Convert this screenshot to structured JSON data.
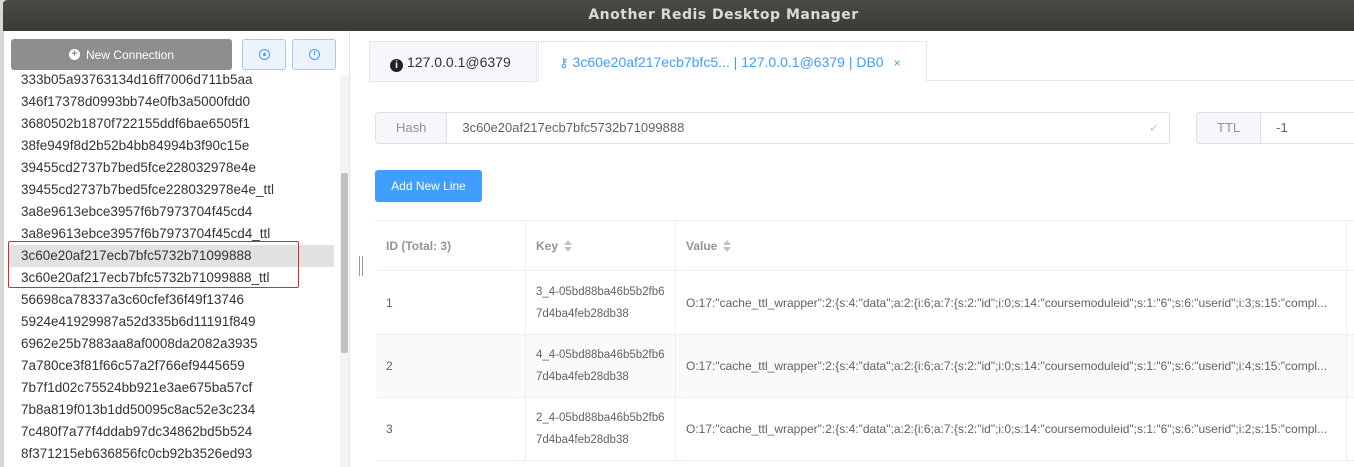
{
  "window": {
    "title": "Another Redis Desktop Manager"
  },
  "sidebar": {
    "new_connection_label": "New Connection",
    "keys": [
      "333b05a93763134d16ff7006d711b5aa",
      "346f17378d0993bb74e0fb3a5000fdd0",
      "3680502b1870f722155ddf6bae6505f1",
      "38fe949f8d2b52b4bb84994b3f90c15e",
      "39455cd2737b7bed5fce228032978e4e",
      "39455cd2737b7bed5fce228032978e4e_ttl",
      "3a8e9613ebce3957f6b7973704f45cd4",
      "3a8e9613ebce3957f6b7973704f45cd4_ttl",
      "3c60e20af217ecb7bfc5732b71099888",
      "3c60e20af217ecb7bfc5732b71099888_ttl",
      "56698ca78337a3c60cfef36f49f13746",
      "5924e41929987a52d335b6d11191f849",
      "6962e25b7883aa8af0008da2082a3935",
      "7a780ce3f81f66c57a2f766ef9445659",
      "7b7f1d02c75524bb921e3ae675ba57cf",
      "7b8a819f013b1dd50095c8ac52e3c234",
      "7c480f7a77f4ddab97dc34862bd5b524",
      "8f371215eb636856fc0cb92b3526ed93"
    ],
    "selected_index": 8
  },
  "tabs": [
    {
      "label": "127.0.0.1@6379",
      "icon": "info-icon"
    },
    {
      "label": "3c60e20af217ecb7bfc5... | 127.0.0.1@6379 | DB0",
      "icon": "key-icon",
      "close": "×"
    }
  ],
  "key_bar": {
    "type_label": "Hash",
    "key_name": "3c60e20af217ecb7bfc5732b71099888",
    "ttl_label": "TTL",
    "ttl_value": "-1"
  },
  "add_line_label": "Add New Line",
  "table": {
    "headers": {
      "id": "ID (Total: 3)",
      "key": "Key",
      "value": "Value"
    },
    "rows": [
      {
        "id": "1",
        "key": "3_4-05bd88ba46b5b2fb67d4ba4feb28db38",
        "value": "O:17:\"cache_ttl_wrapper\":2:{s:4:\"data\";a:2:{i:6;a:7:{s:2:\"id\";i:0;s:14:\"coursemoduleid\";s:1:\"6\";s:6:\"userid\";i:3;s:15:\"compl..."
      },
      {
        "id": "2",
        "key": "4_4-05bd88ba46b5b2fb67d4ba4feb28db38",
        "value": "O:17:\"cache_ttl_wrapper\":2:{s:4:\"data\";a:2:{i:6;a:7:{s:2:\"id\";i:0;s:14:\"coursemoduleid\";s:1:\"6\";s:6:\"userid\";i:4;s:15:\"compl..."
      },
      {
        "id": "3",
        "key": "2_4-05bd88ba46b5b2fb67d4ba4feb28db38",
        "value": "O:17:\"cache_ttl_wrapper\":2:{s:4:\"data\";a:2:{i:6;a:7:{s:2:\"id\";i:0;s:14:\"coursemoduleid\";s:1:\"6\";s:6:\"userid\";i:2;s:15:\"compl..."
      }
    ]
  }
}
